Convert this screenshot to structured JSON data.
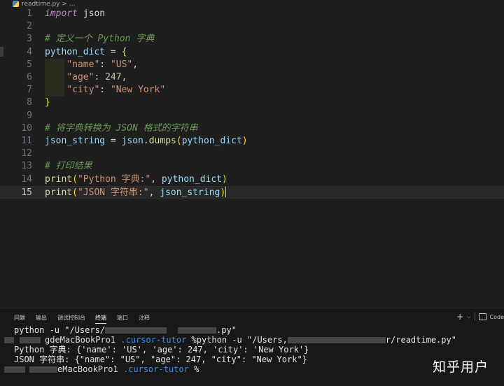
{
  "breadcrumb": {
    "file_icon": "python-file-icon",
    "text": "readtime.py > ..."
  },
  "editor": {
    "lines": [
      {
        "num": "1",
        "tokens": [
          {
            "t": "import",
            "c": "kw"
          },
          {
            "t": " json",
            "c": "plain"
          }
        ]
      },
      {
        "num": "2",
        "tokens": []
      },
      {
        "num": "3",
        "tokens": [
          {
            "t": "# 定义一个 Python 字典",
            "c": "cmt"
          }
        ]
      },
      {
        "num": "4",
        "tokens": [
          {
            "t": "python_dict",
            "c": "var"
          },
          {
            "t": " = ",
            "c": "plain"
          },
          {
            "t": "{",
            "c": "br1"
          }
        ]
      },
      {
        "num": "5",
        "indent": true,
        "tokens": [
          {
            "t": "    ",
            "c": "plain"
          },
          {
            "t": "\"name\"",
            "c": "str"
          },
          {
            "t": ": ",
            "c": "plain"
          },
          {
            "t": "\"US\"",
            "c": "str"
          },
          {
            "t": ",",
            "c": "plain"
          }
        ]
      },
      {
        "num": "6",
        "indent": true,
        "tokens": [
          {
            "t": "    ",
            "c": "plain"
          },
          {
            "t": "\"age\"",
            "c": "str"
          },
          {
            "t": ": ",
            "c": "plain"
          },
          {
            "t": "247",
            "c": "num"
          },
          {
            "t": ",",
            "c": "plain"
          }
        ]
      },
      {
        "num": "7",
        "indent": true,
        "tokens": [
          {
            "t": "    ",
            "c": "plain"
          },
          {
            "t": "\"city\"",
            "c": "str"
          },
          {
            "t": ": ",
            "c": "plain"
          },
          {
            "t": "\"New York\"",
            "c": "str"
          }
        ]
      },
      {
        "num": "8",
        "tokens": [
          {
            "t": "}",
            "c": "br1"
          }
        ]
      },
      {
        "num": "9",
        "tokens": []
      },
      {
        "num": "10",
        "tokens": [
          {
            "t": "# 将字典转换为 JSON 格式的字符串",
            "c": "cmt"
          }
        ]
      },
      {
        "num": "11",
        "tokens": [
          {
            "t": "json_string",
            "c": "var"
          },
          {
            "t": " = ",
            "c": "plain"
          },
          {
            "t": "json",
            "c": "var"
          },
          {
            "t": ".",
            "c": "plain"
          },
          {
            "t": "dumps",
            "c": "fn"
          },
          {
            "t": "(",
            "c": "br1"
          },
          {
            "t": "python_dict",
            "c": "var"
          },
          {
            "t": ")",
            "c": "br1"
          }
        ]
      },
      {
        "num": "12",
        "tokens": []
      },
      {
        "num": "13",
        "tokens": [
          {
            "t": "# 打印结果",
            "c": "cmt"
          }
        ]
      },
      {
        "num": "14",
        "tokens": [
          {
            "t": "print",
            "c": "fn"
          },
          {
            "t": "(",
            "c": "br1"
          },
          {
            "t": "\"Python 字典:\"",
            "c": "str"
          },
          {
            "t": ", ",
            "c": "plain"
          },
          {
            "t": "python_dict",
            "c": "var"
          },
          {
            "t": ")",
            "c": "br1"
          }
        ]
      },
      {
        "num": "15",
        "active": true,
        "cursor": true,
        "tokens": [
          {
            "t": "print",
            "c": "fn"
          },
          {
            "t": "(",
            "c": "br1"
          },
          {
            "t": "\"JSON 字符串:\"",
            "c": "str"
          },
          {
            "t": ", ",
            "c": "plain"
          },
          {
            "t": "json_string",
            "c": "var"
          },
          {
            "t": ")",
            "c": "br1"
          }
        ]
      }
    ]
  },
  "panel": {
    "tabs": [
      "问题",
      "输出",
      "调试控制台",
      "终端",
      "端口",
      "注释"
    ],
    "active_tab": "终端",
    "actions": {
      "add": "+",
      "dropdown": "⌵",
      "terminal_label": "Code"
    }
  },
  "terminal": {
    "line1_start": "python -u \"/Users/",
    "line1_end": ".py\"",
    "line2_host": "gdeMacBookPro1",
    "line2_dir": ".cursor-tutor",
    "line2_cmd_a": " %python -u \"/Users,",
    "line2_cmd_b": "r/readtime.py\"",
    "line3": "Python 字典: {'name': 'US', 'age': 247, 'city': 'New York'}",
    "line4": "JSON 字符串: {\"name\": \"US\", \"age\": 247, \"city\": \"New York\"}",
    "line5_host": "eMacBookPro1",
    "line5_dir": ".cursor-tutor",
    "line5_prompt": " %"
  },
  "watermark": "知乎用户"
}
